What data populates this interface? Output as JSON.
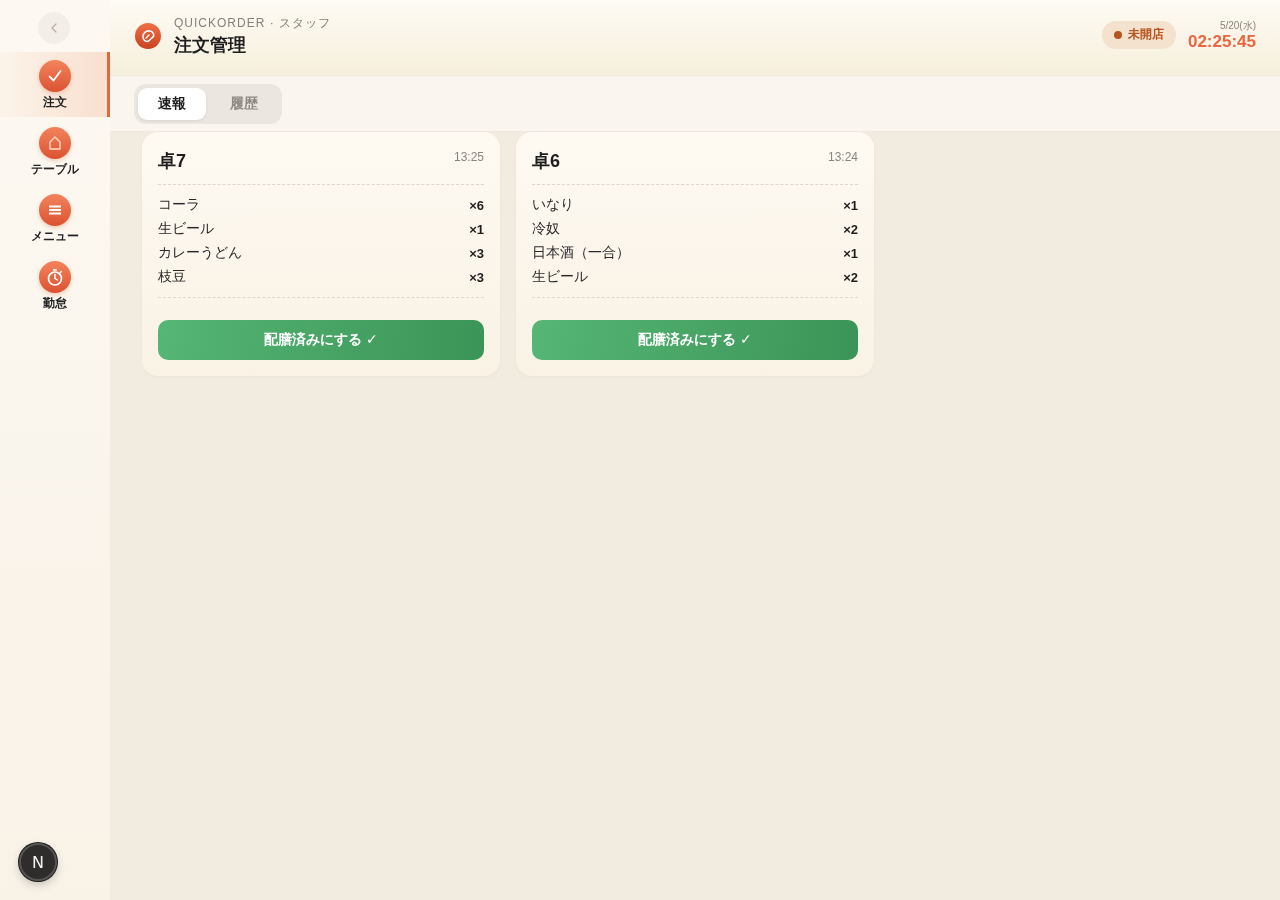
{
  "sidebar": {
    "items": [
      {
        "kind": "orders",
        "label": "注文",
        "selected": true
      },
      {
        "kind": "tables",
        "label": "テーブル",
        "selected": false
      },
      {
        "kind": "menu",
        "label": "メニュー",
        "selected": false
      },
      {
        "kind": "attendance",
        "label": "勤怠",
        "selected": false
      }
    ]
  },
  "header": {
    "subtitle": "QUICKORDER · スタッフ",
    "title": "注文管理",
    "status": {
      "label": "未開店",
      "open": false
    },
    "date": "5/20(水)",
    "time": "02:25:45"
  },
  "tabs": [
    {
      "label": "速報",
      "selected": true
    },
    {
      "label": "履歴",
      "selected": false
    }
  ],
  "orders": [
    {
      "table": "卓7",
      "time": "13:25",
      "items": [
        {
          "name": "コーラ",
          "quantity": "×6"
        },
        {
          "name": "生ビール",
          "quantity": "×1"
        },
        {
          "name": "カレーうどん",
          "quantity": "×3"
        },
        {
          "name": "枝豆",
          "quantity": "×3"
        }
      ],
      "action": "配膳済みにする ✓"
    },
    {
      "table": "卓6",
      "time": "13:24",
      "items": [
        {
          "name": "いなり",
          "quantity": "×1"
        },
        {
          "name": "冷奴",
          "quantity": "×2"
        },
        {
          "name": "日本酒（一合）",
          "quantity": "×1"
        },
        {
          "name": "生ビール",
          "quantity": "×2"
        }
      ],
      "action": "配膳済みにする ✓"
    }
  ],
  "dev_indicator": {
    "label": "N"
  }
}
